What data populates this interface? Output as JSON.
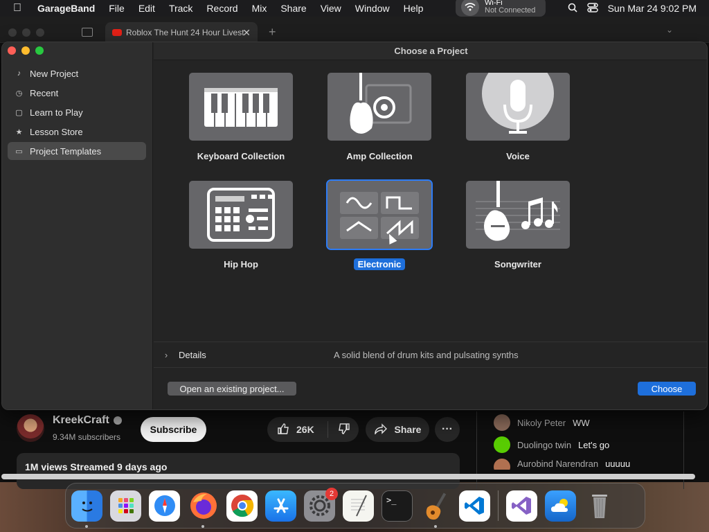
{
  "menubar": {
    "app_name": "GarageBand",
    "items": [
      "File",
      "Edit",
      "Track",
      "Record",
      "Mix",
      "Share",
      "View",
      "Window",
      "Help"
    ],
    "wifi_title": "Wi-Fi",
    "wifi_status": "Not Connected",
    "datetime": "Sun Mar 24  9:02 PM"
  },
  "browser": {
    "tab_title": "Roblox The Hunt 24 Hour Livest",
    "channel": "KreekCraft",
    "subscribers": "9.34M subscribers",
    "subscribe_label": "Subscribe",
    "likes": "26K",
    "share_label": "Share",
    "description": "1M views  Streamed 9 days ago",
    "chat": [
      {
        "name": "Nikoly Peter",
        "msg": "WW",
        "color": "#8a6a5a"
      },
      {
        "name": "Duolingo twin",
        "msg": "Let's go",
        "color": "#58cc02"
      },
      {
        "name": "Aurobind Narendran",
        "msg": "uuuuu",
        "color": "#b07050"
      }
    ]
  },
  "dialog": {
    "title": "Choose a Project",
    "sidebar": [
      {
        "label": "New Project",
        "icon": "music-note-icon"
      },
      {
        "label": "Recent",
        "icon": "clock-icon"
      },
      {
        "label": "Learn to Play",
        "icon": "guitar-icon"
      },
      {
        "label": "Lesson Store",
        "icon": "star-icon"
      },
      {
        "label": "Project Templates",
        "icon": "folder-icon",
        "selected": true
      }
    ],
    "templates": [
      {
        "label": "Keyboard Collection"
      },
      {
        "label": "Amp Collection"
      },
      {
        "label": "Voice"
      },
      {
        "label": "Hip Hop"
      },
      {
        "label": "Electronic",
        "selected": true
      },
      {
        "label": "Songwriter"
      }
    ],
    "details_label": "Details",
    "details_desc": "A solid blend of drum kits and pulsating synths",
    "open_label": "Open an existing project...",
    "choose_label": "Choose"
  },
  "dock": {
    "apps": [
      "Finder",
      "Launchpad",
      "Safari",
      "Firefox",
      "Chrome",
      "App Store",
      "System Settings",
      "TextEdit",
      "Terminal",
      "GarageBand",
      "VS Code",
      "Visual Studio",
      "Weather",
      "Trash"
    ],
    "settings_badge": "2"
  },
  "colors": {
    "accent": "#1e6fdb",
    "menubar": "#1c1c1e",
    "dialog_bg": "#242424"
  }
}
